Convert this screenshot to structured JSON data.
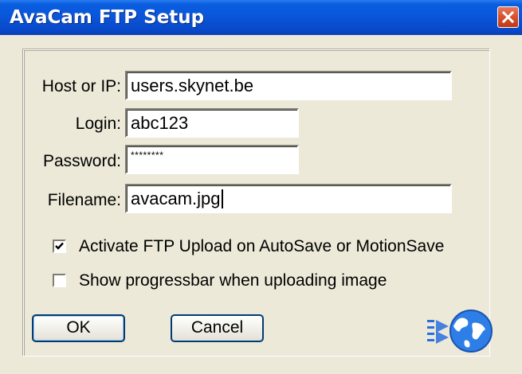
{
  "window": {
    "title": "AvaCam FTP Setup"
  },
  "form": {
    "host": {
      "label": "Host or IP:",
      "value": "users.skynet.be"
    },
    "login": {
      "label": "Login:",
      "value": "abc123"
    },
    "password": {
      "label": "Password:",
      "value": "********"
    },
    "filename": {
      "label": "Filename:",
      "value": "avacam.jpg"
    }
  },
  "options": {
    "activate_ftp": {
      "label": "Activate FTP Upload on AutoSave or MotionSave",
      "checked": true
    },
    "show_progress": {
      "label": "Show progressbar when uploading image",
      "checked": false
    }
  },
  "buttons": {
    "ok": "OK",
    "cancel": "Cancel"
  },
  "icons": {
    "close": "close-icon",
    "globe": "ftp-globe-icon",
    "checkmark": "checkmark-icon"
  },
  "colors": {
    "titlebar": "#0a54d8",
    "close": "#d8502c",
    "dialog_bg": "#ece9d8",
    "button_border": "#003c74"
  }
}
